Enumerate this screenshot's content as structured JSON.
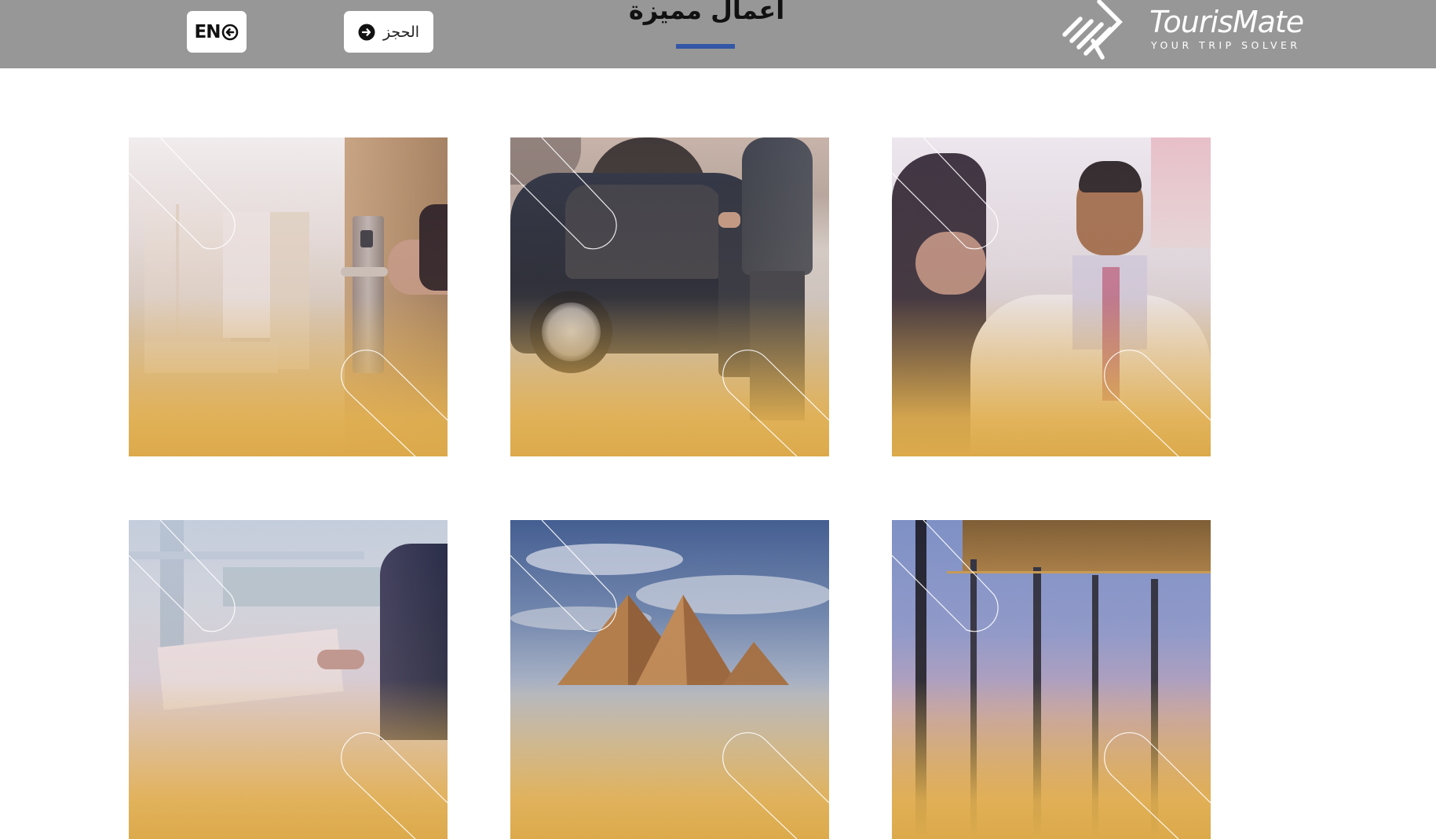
{
  "header": {
    "language_label": "EN",
    "booking_label": "الحجز",
    "title": "أعمال مميزة",
    "logo": {
      "name": "TourisMate",
      "tagline": "YOUR TRIP SOLVER"
    }
  },
  "colors": {
    "header_bg": "#979797",
    "title_underline": "#3356a6",
    "overlay_gold": "#dcae55",
    "overlay_lavender": "#c8b4d8"
  },
  "cards": [
    {
      "subject": "hotel room door with key card lock"
    },
    {
      "subject": "chauffeur opening luxury black car door"
    },
    {
      "subject": "smiling doctor in white coat with patient"
    },
    {
      "subject": "business meeting with documents"
    },
    {
      "subject": "pyramids of Giza under cloudy sky"
    },
    {
      "subject": "glass resort lounge at sunset"
    }
  ]
}
